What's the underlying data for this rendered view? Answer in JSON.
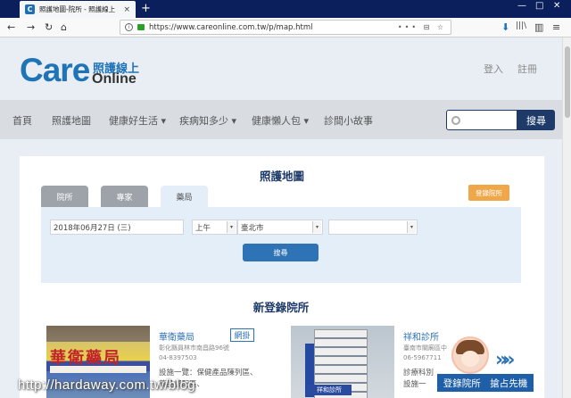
{
  "browser": {
    "tab_title": "照護地圖-院所 - 照護線上",
    "tab_favicon": "C",
    "tab_close": "×",
    "new_tab": "+",
    "window_controls": [
      "—",
      "□",
      "✕"
    ],
    "nav": {
      "back": "←",
      "forward": "→",
      "reload": "↻",
      "home": "⌂"
    },
    "url": "https://www.careonline.com.tw/p/map.html",
    "url_icons": "••• ⊟ ☆",
    "toolbar_icons": {
      "download": "⬇",
      "library": "|||\\",
      "sidebar": "▥",
      "menu": "≡"
    }
  },
  "site": {
    "logo": {
      "care": "Care",
      "zh": "照護線上",
      "online": "Online"
    },
    "header_links": {
      "login": "登入",
      "register": "註冊"
    },
    "menu": [
      "首頁",
      "照護地圖",
      "健康好生活 ▾",
      "疾病知多少 ▾",
      "健康懶人包 ▾",
      "診間小故事"
    ],
    "search": {
      "placeholder": "",
      "button": "搜尋"
    }
  },
  "map_card": {
    "title": "照護地圖",
    "tabs": [
      {
        "label": "院所",
        "active": false
      },
      {
        "label": "專家",
        "active": false
      },
      {
        "label": "藥局",
        "active": true
      }
    ],
    "register_button": "登錄院所",
    "form": {
      "date": "2018年06月27日 (三)",
      "period": "上午",
      "city": "臺北市",
      "district": "",
      "dropdown_glyph": "▾",
      "search_button": "搜尋"
    }
  },
  "new_listings": {
    "title": "新登錄院所",
    "items": [
      {
        "name": "華衛藥局",
        "tag": "網掛",
        "address": "彰化縣員林市南昌路96號",
        "phone": "04-8397503",
        "desc": "設施一覽：保健產品陳列區、藥品調配區、",
        "photo_sign": "華衛藥局"
      },
      {
        "name": "祥和診所",
        "tag": "",
        "address": "臺南市關廟區中",
        "phone": "06-5967711",
        "desc": "診療科別",
        "desc2": "設施一",
        "photo_sign": "祥和診所"
      }
    ]
  },
  "promo": {
    "label": "登錄院所　搶占先機",
    "arrows": "»»"
  },
  "watermark": "http://hardaway.com.tw/blog"
}
